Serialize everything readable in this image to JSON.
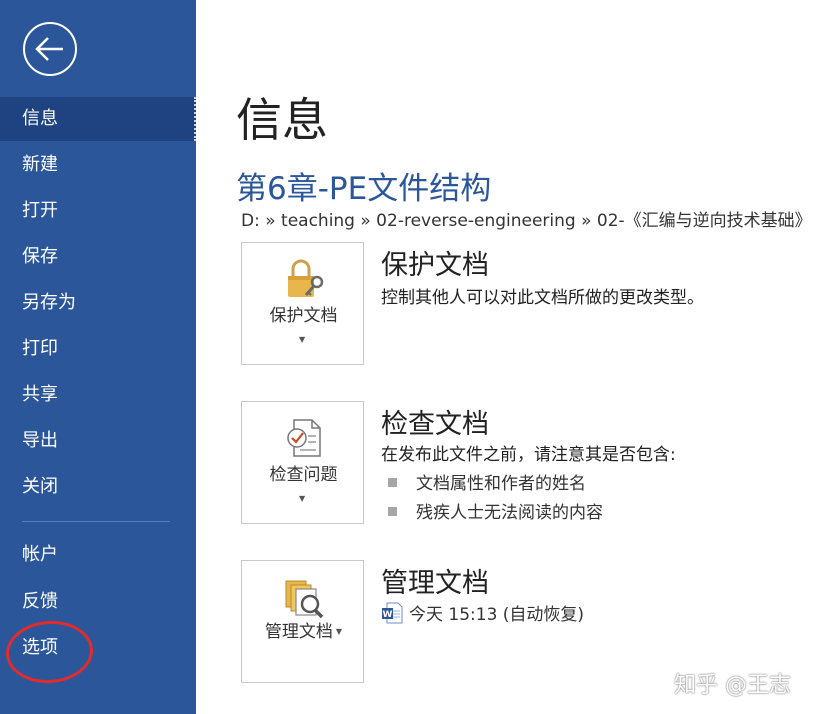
{
  "sidebar": {
    "items": [
      {
        "label": "信息"
      },
      {
        "label": "新建"
      },
      {
        "label": "打开"
      },
      {
        "label": "保存"
      },
      {
        "label": "另存为"
      },
      {
        "label": "打印"
      },
      {
        "label": "共享"
      },
      {
        "label": "导出"
      },
      {
        "label": "关闭"
      },
      {
        "label": "帐户"
      },
      {
        "label": "反馈"
      },
      {
        "label": "选项"
      }
    ],
    "active_index": 0,
    "annotation_color": "#e32b2b"
  },
  "main": {
    "title": "信息",
    "document_title": "第6章-PE文件结构",
    "path": "D: » teaching » 02-reverse-engineering » 02-《汇编与逆向技术基础》",
    "protect": {
      "button_label": "保护文档",
      "title": "保护文档",
      "description": "控制其他人可以对此文档所做的更改类型。"
    },
    "inspect": {
      "button_label": "检查问题",
      "title": "检查文档",
      "description": "在发布此文件之前，请注意其是否包含:",
      "bullets": [
        "文档属性和作者的姓名",
        "残疾人士无法阅读的内容"
      ]
    },
    "manage": {
      "button_label": "管理文档",
      "title": "管理文档",
      "version": "今天 15:13 (自动恢复)"
    }
  },
  "watermark": "知乎 @王志",
  "colors": {
    "sidebar": "#2b579a",
    "sidebar_active": "#1e4380",
    "accent": "#2b579a"
  }
}
